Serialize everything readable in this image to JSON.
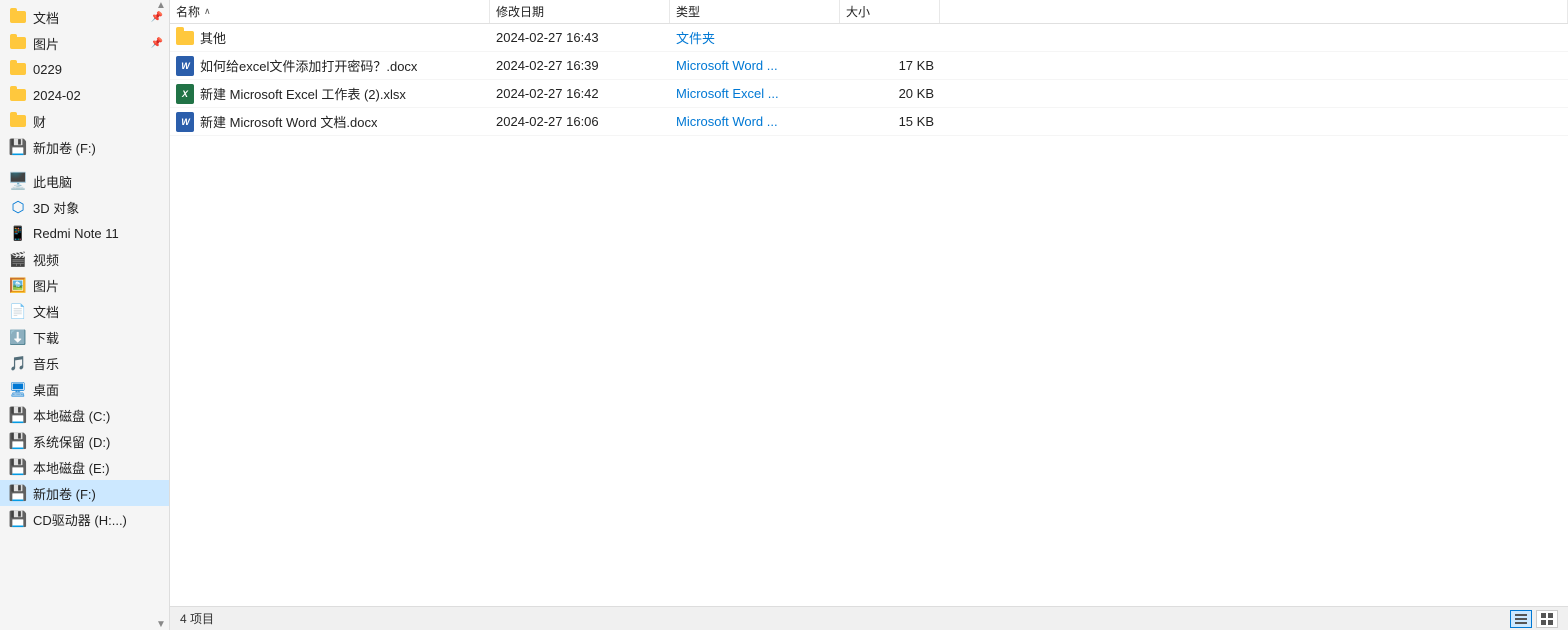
{
  "sidebar": {
    "items": [
      {
        "id": "documents",
        "label": "文档",
        "type": "folder-pin",
        "pinned": true
      },
      {
        "id": "pictures",
        "label": "图片",
        "type": "folder-pin",
        "pinned": true
      },
      {
        "id": "folder-0229",
        "label": "0229",
        "type": "folder"
      },
      {
        "id": "folder-2024-02",
        "label": "2024-02",
        "type": "folder"
      },
      {
        "id": "folder-cai",
        "label": "财",
        "type": "folder"
      },
      {
        "id": "drive-f",
        "label": "新加卷 (F:)",
        "type": "drive"
      },
      {
        "id": "this-pc",
        "label": "此电脑",
        "type": "pc"
      },
      {
        "id": "3d-objects",
        "label": "3D 对象",
        "type": "3d"
      },
      {
        "id": "redmi-note-11",
        "label": "Redmi Note 11",
        "type": "phone"
      },
      {
        "id": "videos",
        "label": "视频",
        "type": "video"
      },
      {
        "id": "pictures2",
        "label": "图片",
        "type": "pic"
      },
      {
        "id": "documents2",
        "label": "文档",
        "type": "doc"
      },
      {
        "id": "downloads",
        "label": "下载",
        "type": "dl"
      },
      {
        "id": "music",
        "label": "音乐",
        "type": "music"
      },
      {
        "id": "desktop",
        "label": "桌面",
        "type": "desktop"
      },
      {
        "id": "local-c",
        "label": "本地磁盘 (C:)",
        "type": "drive"
      },
      {
        "id": "system-d",
        "label": "系统保留 (D:)",
        "type": "drive"
      },
      {
        "id": "local-e",
        "label": "本地磁盘 (E:)",
        "type": "drive"
      },
      {
        "id": "new-f",
        "label": "新加卷 (F:)",
        "type": "drive",
        "active": true
      },
      {
        "id": "cd-drive",
        "label": "CD驱动器 (H:...)",
        "type": "drive"
      }
    ]
  },
  "columns": {
    "name": {
      "label": "名称",
      "sort": "asc"
    },
    "date": {
      "label": "修改日期"
    },
    "type": {
      "label": "类型"
    },
    "size": {
      "label": "大小"
    }
  },
  "files": [
    {
      "id": "f1",
      "name": "其他",
      "date": "2024-02-27 16:43",
      "type": "文件夹",
      "size": "",
      "file_type": "folder"
    },
    {
      "id": "f2",
      "name": "如何给excel文件添加打开密码？.docx",
      "date": "2024-02-27 16:39",
      "type": "Microsoft Word ...",
      "size": "17 KB",
      "file_type": "word"
    },
    {
      "id": "f3",
      "name": "新建 Microsoft Excel 工作表 (2).xlsx",
      "date": "2024-02-27 16:42",
      "type": "Microsoft Excel ...",
      "size": "20 KB",
      "file_type": "excel"
    },
    {
      "id": "f4",
      "name": "新建 Microsoft Word 文档.docx",
      "date": "2024-02-27 16:06",
      "type": "Microsoft Word ...",
      "size": "15 KB",
      "file_type": "word"
    }
  ],
  "statusbar": {
    "items_count": "4 项目",
    "view_detail_label": "详细信息",
    "view_large_label": "大图标"
  }
}
